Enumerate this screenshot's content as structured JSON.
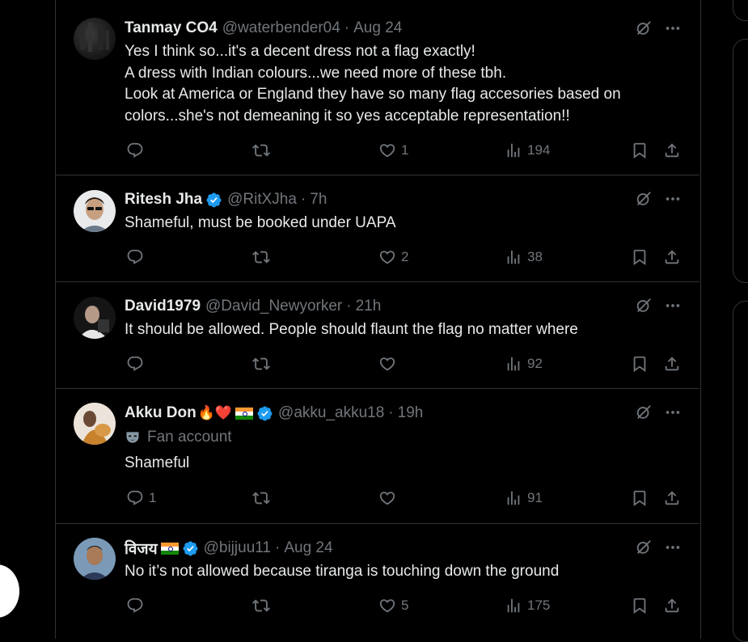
{
  "replies": [
    {
      "name": "Tanmay CO4",
      "handle": "@waterbender04",
      "time": "Aug 24",
      "lines": [
        "Yes I think so...it's a decent dress not a flag exactly!",
        "A dress with Indian colours...we need more of these tbh.",
        "Look at America or England they have so many flag accesories based on",
        "colors...she's not demeaning it so yes acceptable representation!!"
      ],
      "likes": "1",
      "views": "194"
    },
    {
      "name": "Ritesh Jha",
      "handle": "@RitXJha",
      "time": "7h",
      "lines": [
        "Shameful, must be booked under UAPA"
      ],
      "likes": "2",
      "views": "38"
    },
    {
      "name": "David1979",
      "handle": "@David_Newyorker",
      "time": "21h",
      "lines": [
        "It should be allowed. People should flaunt the flag no matter where"
      ],
      "views": "92"
    },
    {
      "name": "Akku Don",
      "name_emoji": "🔥❤️",
      "handle": "@akku_akku18",
      "time": "19h",
      "label": "Fan account",
      "lines": [
        "Shameful"
      ],
      "replies": "1",
      "views": "91"
    },
    {
      "name": "विजय",
      "handle": "@bijjuu11",
      "time": "Aug 24",
      "lines": [
        "No it’s not allowed because tiranga is touching down the ground"
      ],
      "likes": "5",
      "views": "175"
    }
  ],
  "separator": "·",
  "colors": {
    "background": "#000000",
    "text": "#e7e9ea",
    "muted": "#71767b",
    "verified": "#1d9bf0",
    "border": "#2f3336"
  }
}
